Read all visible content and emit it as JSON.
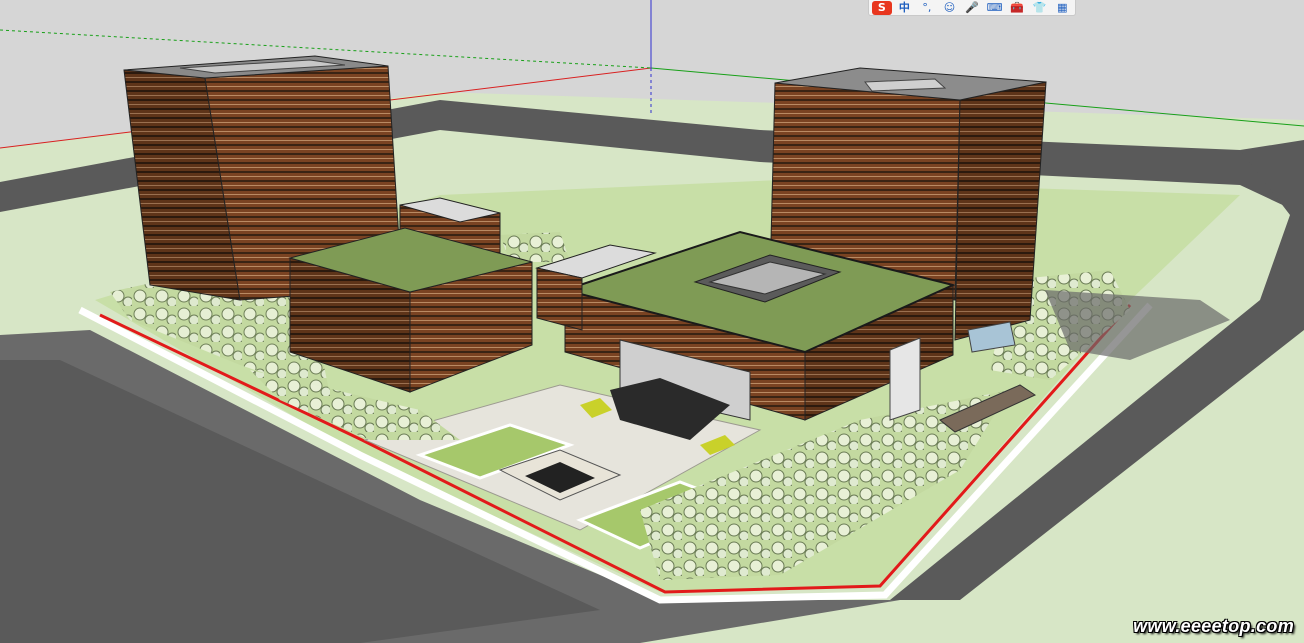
{
  "canvas": {
    "sky_color": "#d6d6d6",
    "ground_color": "#d7e6c6",
    "road_color": "#5a5a5a",
    "grass_color": "#b9d58e",
    "facade_color": "#7a4322",
    "roof_color": "#7f9b55",
    "boundary_color": "#e21a1a",
    "axis_red": "#d82020",
    "axis_green": "#18a018",
    "axis_blue": "#3030d0"
  },
  "ime_toolbar": {
    "logo": "S",
    "lang": "中",
    "icons": [
      "punctuation-icon",
      "emoji-icon",
      "microphone-icon",
      "keyboard-icon",
      "toolbox-icon",
      "skin-icon",
      "menu-grid-icon"
    ],
    "glyphs": [
      "°,",
      "☺",
      "🎤",
      "⌨",
      "🧰",
      "👕",
      "▦"
    ]
  },
  "watermark": "www.eeeetop.com"
}
